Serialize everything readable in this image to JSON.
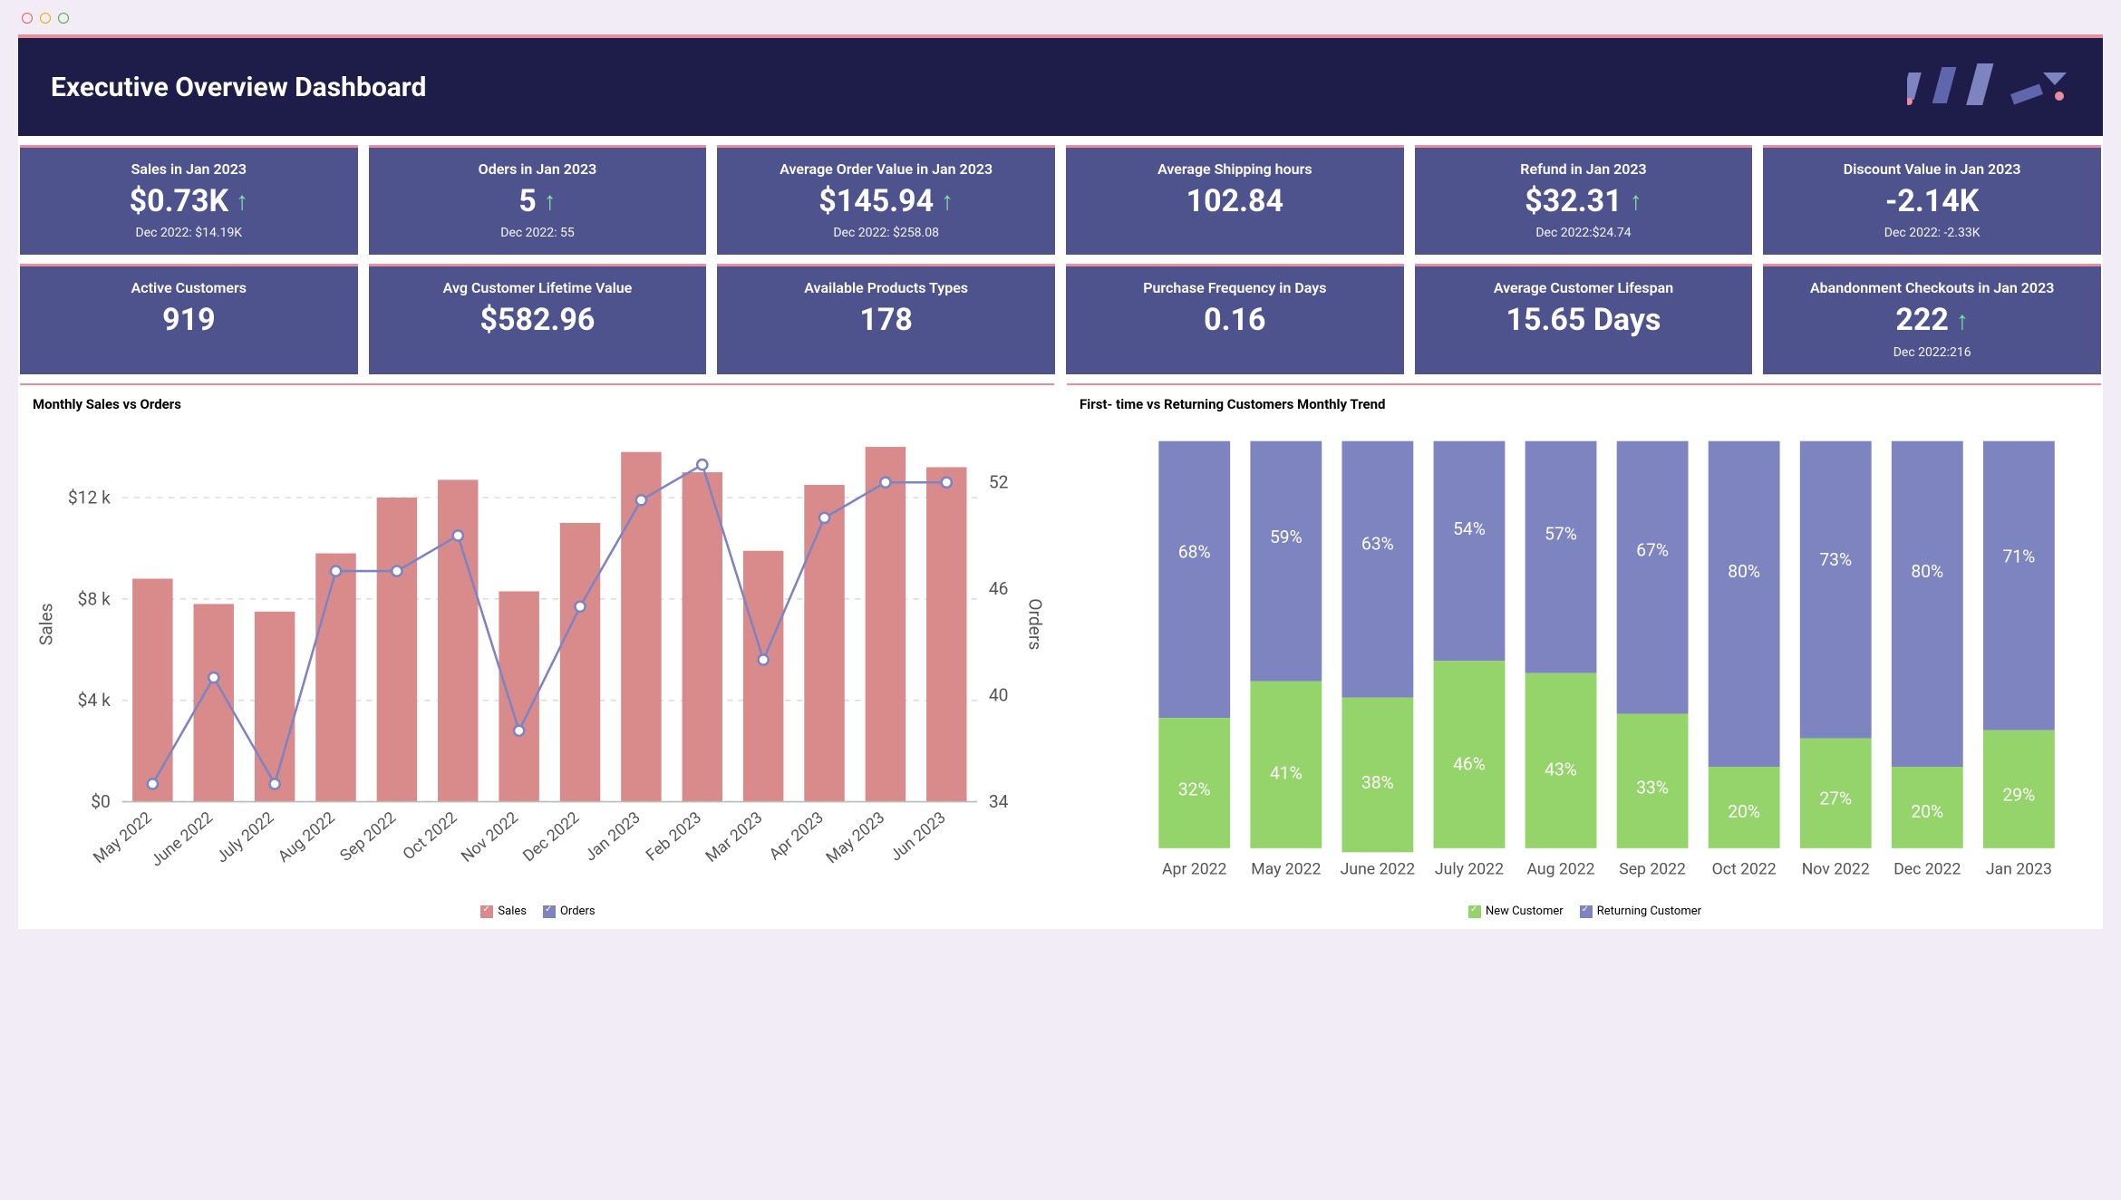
{
  "header": {
    "title": "Executive Overview Dashboard"
  },
  "kpis_row1": [
    {
      "title": "Sales in Jan 2023",
      "value": "$0.73K",
      "arrow": true,
      "foot": "Dec 2022: $14.19K"
    },
    {
      "title": "Oders in Jan 2023",
      "value": "5",
      "arrow": true,
      "foot": "Dec 2022: 55"
    },
    {
      "title": "Average Order Value in Jan 2023",
      "value": "$145.94",
      "arrow": true,
      "foot": "Dec 2022: $258.08"
    },
    {
      "title": "Average Shipping hours",
      "value": "102.84",
      "arrow": false,
      "foot": ""
    },
    {
      "title": "Refund in Jan 2023",
      "value": "$32.31",
      "arrow": true,
      "foot": "Dec 2022:$24.74"
    },
    {
      "title": "Discount Value in Jan 2023",
      "value": "-2.14K",
      "arrow": false,
      "foot": "Dec 2022:  -2.33K"
    }
  ],
  "kpis_row2": [
    {
      "title": "Active Customers",
      "value": "919",
      "arrow": false,
      "foot": ""
    },
    {
      "title": "Avg Customer Lifetime Value",
      "value": "$582.96",
      "arrow": false,
      "foot": ""
    },
    {
      "title": "Available Products Types",
      "value": "178",
      "arrow": false,
      "foot": ""
    },
    {
      "title": "Purchase Frequency in Days",
      "value": "0.16",
      "arrow": false,
      "foot": ""
    },
    {
      "title": "Average Customer Lifespan",
      "value": "15.65 Days",
      "arrow": false,
      "foot": ""
    },
    {
      "title": "Abandonment Checkouts in Jan 2023",
      "value": "222",
      "arrow": true,
      "foot": "Dec 2022:216"
    }
  ],
  "chart1": {
    "title": "Monthly Sales vs Orders",
    "legend": {
      "a": "Sales",
      "b": "Orders"
    },
    "ylabel_left": "Sales",
    "ylabel_right": "Orders"
  },
  "chart2": {
    "title": "First- time vs Returning  Customers Monthly Trend",
    "legend": {
      "a": "New Customer",
      "b": "Returning Customer"
    }
  },
  "chart_data": [
    {
      "type": "bar+line",
      "title": "Monthly Sales vs Orders",
      "categories": [
        "May 2022",
        "June 2022",
        "July 2022",
        "Aug 2022",
        "Sep 2022",
        "Oct 2022",
        "Nov 2022",
        "Dec 2022",
        "Jan 2023",
        "Feb 2023",
        "Mar 2023",
        "Apr 2023",
        "May 2023",
        "Jun 2023"
      ],
      "series": [
        {
          "name": "Sales",
          "axis": "left",
          "type": "bar",
          "values": [
            8800,
            7800,
            7500,
            9800,
            12000,
            12700,
            8300,
            11000,
            13800,
            13000,
            9900,
            12500,
            14000,
            13200
          ]
        },
        {
          "name": "Orders",
          "axis": "right",
          "type": "line",
          "values": [
            35,
            41,
            35,
            47,
            47,
            49,
            38,
            45,
            51,
            53,
            42,
            50,
            52,
            52
          ]
        }
      ],
      "yaxis_left": {
        "label": "Sales",
        "ticks": [
          0,
          4000,
          8000,
          12000
        ],
        "tick_labels": [
          "$0",
          "$4 k",
          "$8 k",
          "$12 k"
        ]
      },
      "yaxis_right": {
        "label": "Orders",
        "ticks": [
          34,
          40,
          46,
          52
        ]
      },
      "colors": {
        "Sales": "#d98b8c",
        "Orders": "#7d84c0"
      }
    },
    {
      "type": "stacked-bar-100",
      "title": "First- time vs Returning Customers Monthly Trend",
      "categories": [
        "Apr 2022",
        "May 2022",
        "June 2022",
        "July 2022",
        "Aug 2022",
        "Sep 2022",
        "Oct 2022",
        "Nov 2022",
        "Dec 2022",
        "Jan 2023"
      ],
      "series": [
        {
          "name": "New Customer",
          "values": [
            32,
            41,
            38,
            46,
            43,
            33,
            20,
            27,
            20,
            29
          ]
        },
        {
          "name": "Returning Customer",
          "values": [
            68,
            59,
            63,
            54,
            57,
            67,
            80,
            73,
            80,
            71
          ]
        }
      ],
      "unit": "%",
      "colors": {
        "New Customer": "#95d46a",
        "Returning Customer": "#7d84c0"
      }
    }
  ]
}
